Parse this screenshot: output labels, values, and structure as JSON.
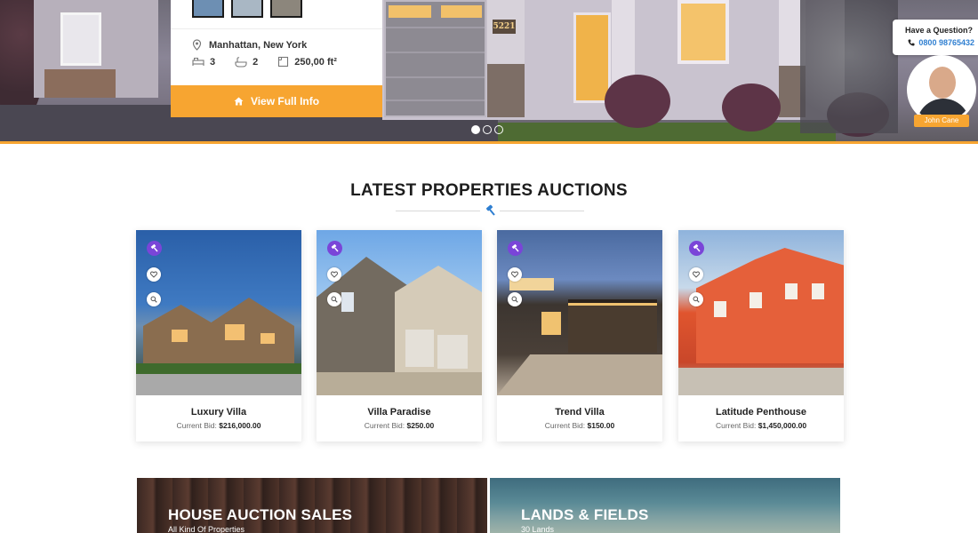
{
  "hero": {
    "location": "Manhattan, New York",
    "beds": "3",
    "baths": "2",
    "area": "250,00 ft²",
    "view_button": "View Full Info",
    "house_number": "5221",
    "slides": 3,
    "active_slide": 1
  },
  "question": {
    "label": "Have a Question?",
    "phone": "0800 98765432",
    "agent_name": "John Cane"
  },
  "section": {
    "title": "LATEST PROPERTIES AUCTIONS"
  },
  "cards": [
    {
      "name": "Luxury Villa",
      "bid_label": "Current Bid:",
      "bid": "$216,000.00"
    },
    {
      "name": "Villa Paradise",
      "bid_label": "Current Bid:",
      "bid": "$250.00"
    },
    {
      "name": "Trend Villa",
      "bid_label": "Current Bid:",
      "bid": "$150.00"
    },
    {
      "name": "Latitude Penthouse",
      "bid_label": "Current Bid:",
      "bid": "$1,450,000.00"
    }
  ],
  "banners": [
    {
      "title": "HOUSE AUCTION SALES",
      "subtitle": "All Kind Of Properties"
    },
    {
      "title": "LANDS & FIELDS",
      "subtitle": "30 Lands"
    }
  ],
  "colors": {
    "accent": "#f7a531",
    "badge": "#7a45d8",
    "link": "#2f7fd1",
    "gavel": "#2f7fd1"
  },
  "icons": [
    "location-pin-icon",
    "bed-icon",
    "bath-icon",
    "area-icon",
    "home-icon",
    "phone-icon",
    "gavel-icon",
    "heart-icon",
    "search-icon"
  ]
}
